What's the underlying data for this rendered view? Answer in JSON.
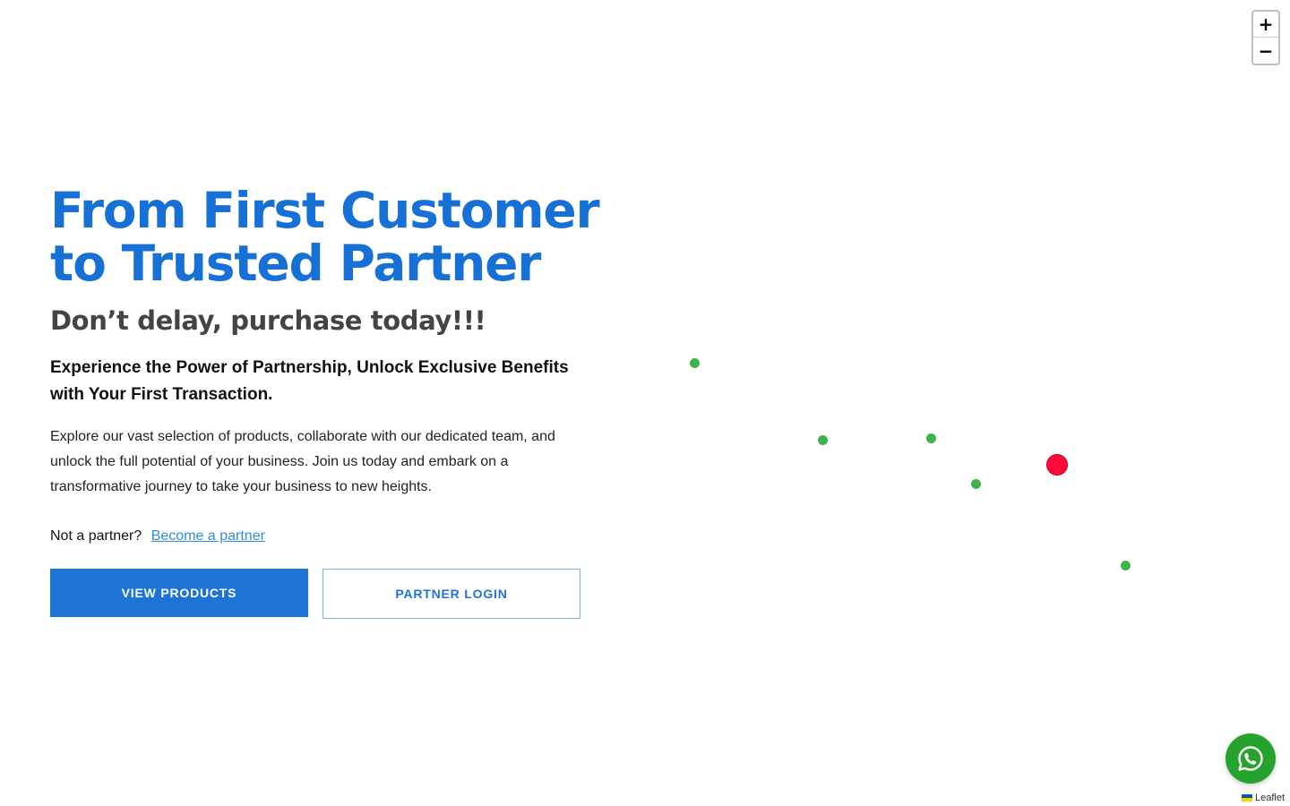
{
  "hero": {
    "headline_line1": "From First Customer",
    "headline_line2": "to Trusted Partner",
    "subhead": "Don’t delay, purchase today!!!",
    "tagline": "Experience the Power of Partnership, Unlock Exclusive Benefits with Your First Transaction.",
    "body": "Explore our vast selection of products, collaborate with our dedicated team, and unlock the full potential of your business. Join us today and embark on a transformative journey to take your business to new heights.",
    "partner_prompt": "Not a partner?",
    "partner_link": "Become a partner",
    "primary_button": "VIEW PRODUCTS",
    "secondary_button": "PARTNER LOGIN"
  },
  "map": {
    "zoom_in": "+",
    "zoom_out": "−",
    "attribution": "Leaflet",
    "markers": [
      {
        "color": "green"
      },
      {
        "color": "green"
      },
      {
        "color": "green"
      },
      {
        "color": "green"
      },
      {
        "color": "red"
      },
      {
        "color": "green"
      }
    ]
  },
  "colors": {
    "brand_blue": "#1670d6",
    "marker_green": "#3cb44b",
    "marker_red": "#ff0b3a",
    "whatsapp_green": "#25a32c"
  },
  "icons": {
    "chat": "whatsapp-icon"
  }
}
